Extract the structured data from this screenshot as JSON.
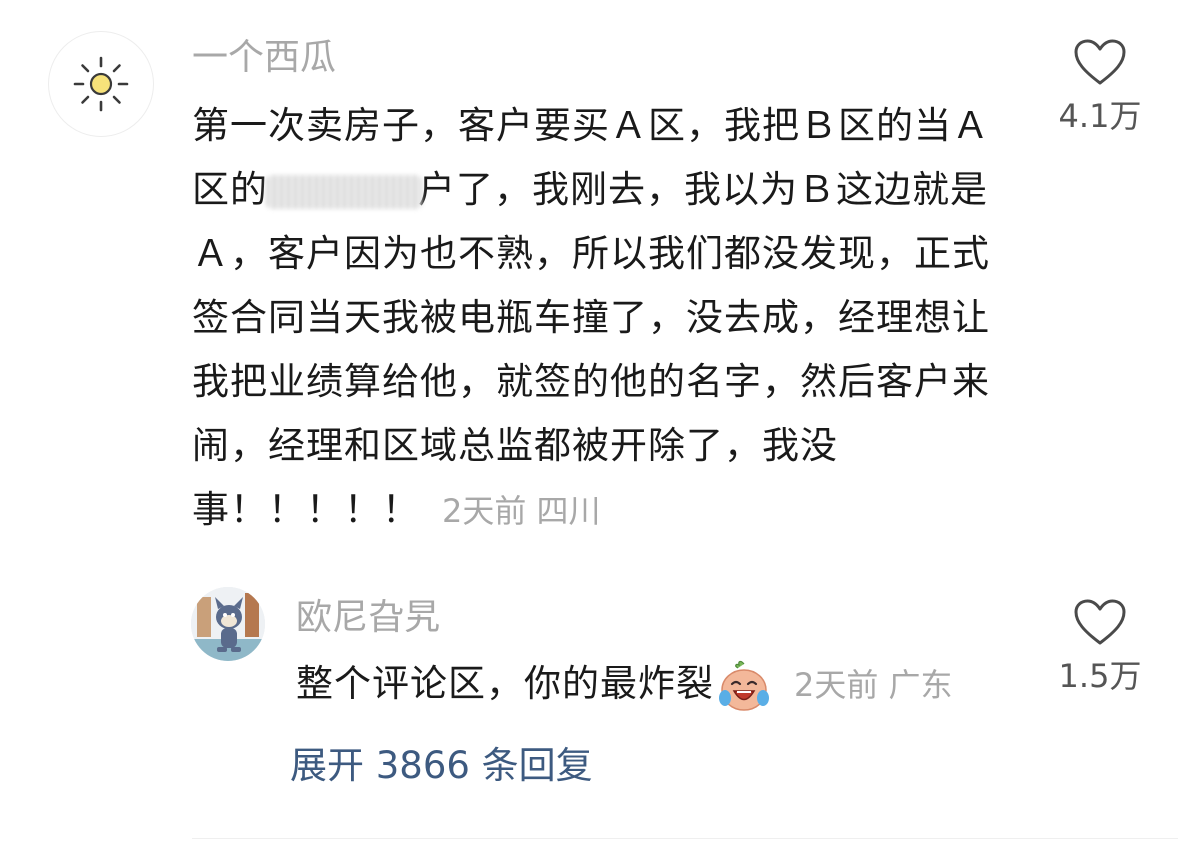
{
  "main_comment": {
    "username": "一个西瓜",
    "text_part1": "第一次卖房子，客户要买Ａ区，我把Ｂ区的当Ａ区的",
    "text_part2": "户了，我刚去，我以为Ｂ这边就是Ａ，客户因为也不熟，所以我们都没发现，正式签合同当天我被电瓶车撞了，没去成，经理想让我把业绩算给他，就签的他的名字，然后客户来闹，经理和区域总监都被开除了，我没事！！！！！",
    "time": "2天前",
    "location": "四川",
    "likes": "4.1万"
  },
  "reply_comment": {
    "username": "欧尼旮旯",
    "text": "整个评论区，你的最炸裂",
    "time": "2天前",
    "location": "广东",
    "likes": "1.5万"
  },
  "expand": {
    "label": "展开 3866 条回复"
  },
  "icons": {
    "avatar_main": "sun-icon",
    "avatar_reply": "cartoon-cat-avatar",
    "like": "heart-outline-icon",
    "emoji": "laughing-tears-emoji"
  },
  "colors": {
    "username": "#a8a8a8",
    "body_text": "#1a1a1a",
    "meta": "#a8a8a8",
    "link": "#3d5a80",
    "like_count": "#555555"
  }
}
